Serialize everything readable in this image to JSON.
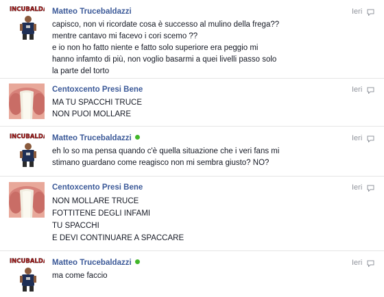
{
  "messages": [
    {
      "sender": "Matteo Trucebaldazzi",
      "online": false,
      "time": "Ieri",
      "lines": [
        "capisco, non vi ricordate cosa è successo al mulino della frega??",
        "mentre cantavo mi facevo i cori scemo ??",
        "e io non ho fatto niente e fatto solo superiore era peggio mi",
        "hanno infamto di più, non voglio basarmi a quei livelli passo solo",
        "la parte del torto"
      ],
      "avatar": "incubaldazzi-logo-avatar",
      "avatar_label": "INCUBALDAZZI"
    },
    {
      "sender": "Centoxcento Presi Bene",
      "online": false,
      "time": "Ieri",
      "lines": [
        "MA TU SPACCHI TRUCE",
        "NON PUOI MOLLARE"
      ],
      "avatar": "mouth-photo-avatar"
    },
    {
      "sender": "Matteo Trucebaldazzi",
      "online": true,
      "time": "Ieri",
      "lines": [
        "eh lo so ma pensa quando c'è quella situazione che i veri fans mi",
        "stimano guardano come reagisco non mi sembra giusto? NO?"
      ],
      "avatar": "incubaldazzi-logo-avatar",
      "avatar_label": "INCUBALDAZZI"
    },
    {
      "sender": "Centoxcento Presi Bene",
      "online": false,
      "time": "Ieri",
      "lines": [
        "NON MOLLARE TRUCE",
        "FOTTITENE DEGLI INFAMI",
        "TU SPACCHI",
        "E DEVI CONTINUARE A SPACCARE"
      ],
      "avatar": "mouth-photo-avatar"
    },
    {
      "sender": "Matteo Trucebaldazzi",
      "online": true,
      "time": "Ieri",
      "lines": [
        "ma come faccio"
      ],
      "avatar": "incubaldazzi-logo-avatar",
      "avatar_label": "INCUBALDAZZI"
    }
  ],
  "colors": {
    "name": "#3b5998",
    "time": "#90949c",
    "online": "#42b72a",
    "divider": "#e5e5e5"
  }
}
